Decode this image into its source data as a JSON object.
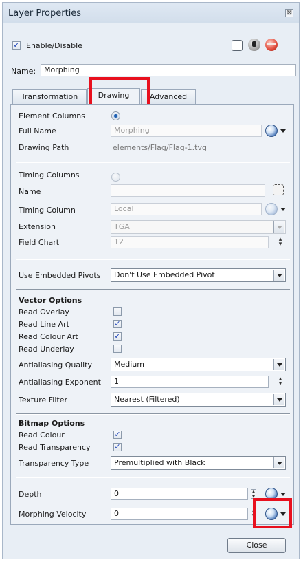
{
  "window": {
    "title": "Layer Properties",
    "close_glyph": "⊠"
  },
  "header": {
    "enable_label": "Enable/Disable",
    "enable_checked": true,
    "name_label": "Name:",
    "name_value": "Morphing",
    "icons": [
      "square-toggle-icon",
      "lock-icon",
      "layer-color-icon"
    ]
  },
  "tabs": [
    {
      "label": "Transformation",
      "active": false
    },
    {
      "label": "Drawing",
      "active": true
    },
    {
      "label": "Advanced",
      "active": false
    }
  ],
  "drawing": {
    "element_columns_label": "Element Columns",
    "full_name_label": "Full Name",
    "full_name_value": "Morphing",
    "drawing_path_label": "Drawing Path",
    "drawing_path_value": "elements/Flag/Flag-1.tvg",
    "timing_columns_label": "Timing Columns",
    "name_label": "Name",
    "name_value": "",
    "timing_column_label": "Timing Column",
    "timing_column_value": "Local",
    "extension_label": "Extension",
    "extension_value": "TGA",
    "field_chart_label": "Field Chart",
    "field_chart_value": "12",
    "use_embedded_pivots_label": "Use Embedded Pivots",
    "use_embedded_pivots_value": "Don't Use Embedded Pivot"
  },
  "vector_options": {
    "title": "Vector Options",
    "read_overlay_label": "Read Overlay",
    "read_overlay": false,
    "read_line_art_label": "Read Line Art",
    "read_line_art": true,
    "read_colour_art_label": "Read Colour Art",
    "read_colour_art": true,
    "read_underlay_label": "Read Underlay",
    "read_underlay": false,
    "antialiasing_quality_label": "Antialiasing Quality",
    "antialiasing_quality_value": "Medium",
    "antialiasing_exponent_label": "Antialiasing Exponent",
    "antialiasing_exponent_value": "1",
    "texture_filter_label": "Texture Filter",
    "texture_filter_value": "Nearest (Filtered)"
  },
  "bitmap_options": {
    "title": "Bitmap Options",
    "read_colour_label": "Read Colour",
    "read_colour": true,
    "read_transparency_label": "Read Transparency",
    "read_transparency": true,
    "transparency_type_label": "Transparency Type",
    "transparency_type_value": "Premultiplied with Black"
  },
  "bottom": {
    "depth_label": "Depth",
    "depth_value": "0",
    "morphing_velocity_label": "Morphing Velocity",
    "morphing_velocity_value": "0"
  },
  "footer": {
    "close_label": "Close"
  },
  "check_glyph": "✓",
  "colors": {
    "highlight": "#e8101e",
    "window_bg": "#e8eef5"
  }
}
